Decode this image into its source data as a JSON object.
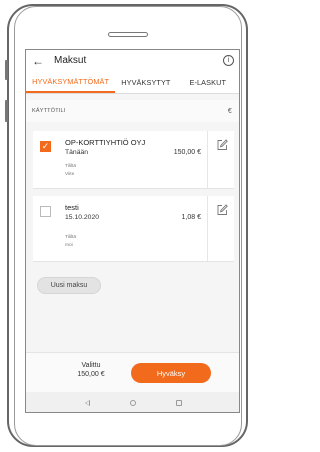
{
  "appbar": {
    "title": "Maksut"
  },
  "tabs": [
    {
      "label": "HYVÄKSYMÄTTÖMÄT",
      "active": true
    },
    {
      "label": "HYVÄKSYTYT",
      "active": false
    },
    {
      "label": "E-LASKUT",
      "active": false
    }
  ],
  "section": {
    "label": "KÄYTTÖTILI",
    "currency": "€"
  },
  "payments": [
    {
      "payee": "OP-KORTTIYHTIÖ OYJ",
      "date": "Tänään",
      "amount": "150,00 €",
      "account_label": "Tililtä",
      "account_value": "Viite",
      "checked": true
    },
    {
      "payee": "testi",
      "date": "15.10.2020",
      "amount": "1,08 €",
      "account_label": "Tililtä",
      "account_value": "moi",
      "checked": false
    }
  ],
  "new_payment_label": "Uusi maksu",
  "footer": {
    "selected_label": "Valittu",
    "selected_value": "150,00 €",
    "approve_label": "Hyväksy"
  },
  "colors": {
    "accent": "#f26a1b"
  },
  "icons": {
    "back": "arrow-left-icon",
    "info": "info-icon",
    "edit": "edit-icon",
    "check": "checkmark-icon"
  }
}
